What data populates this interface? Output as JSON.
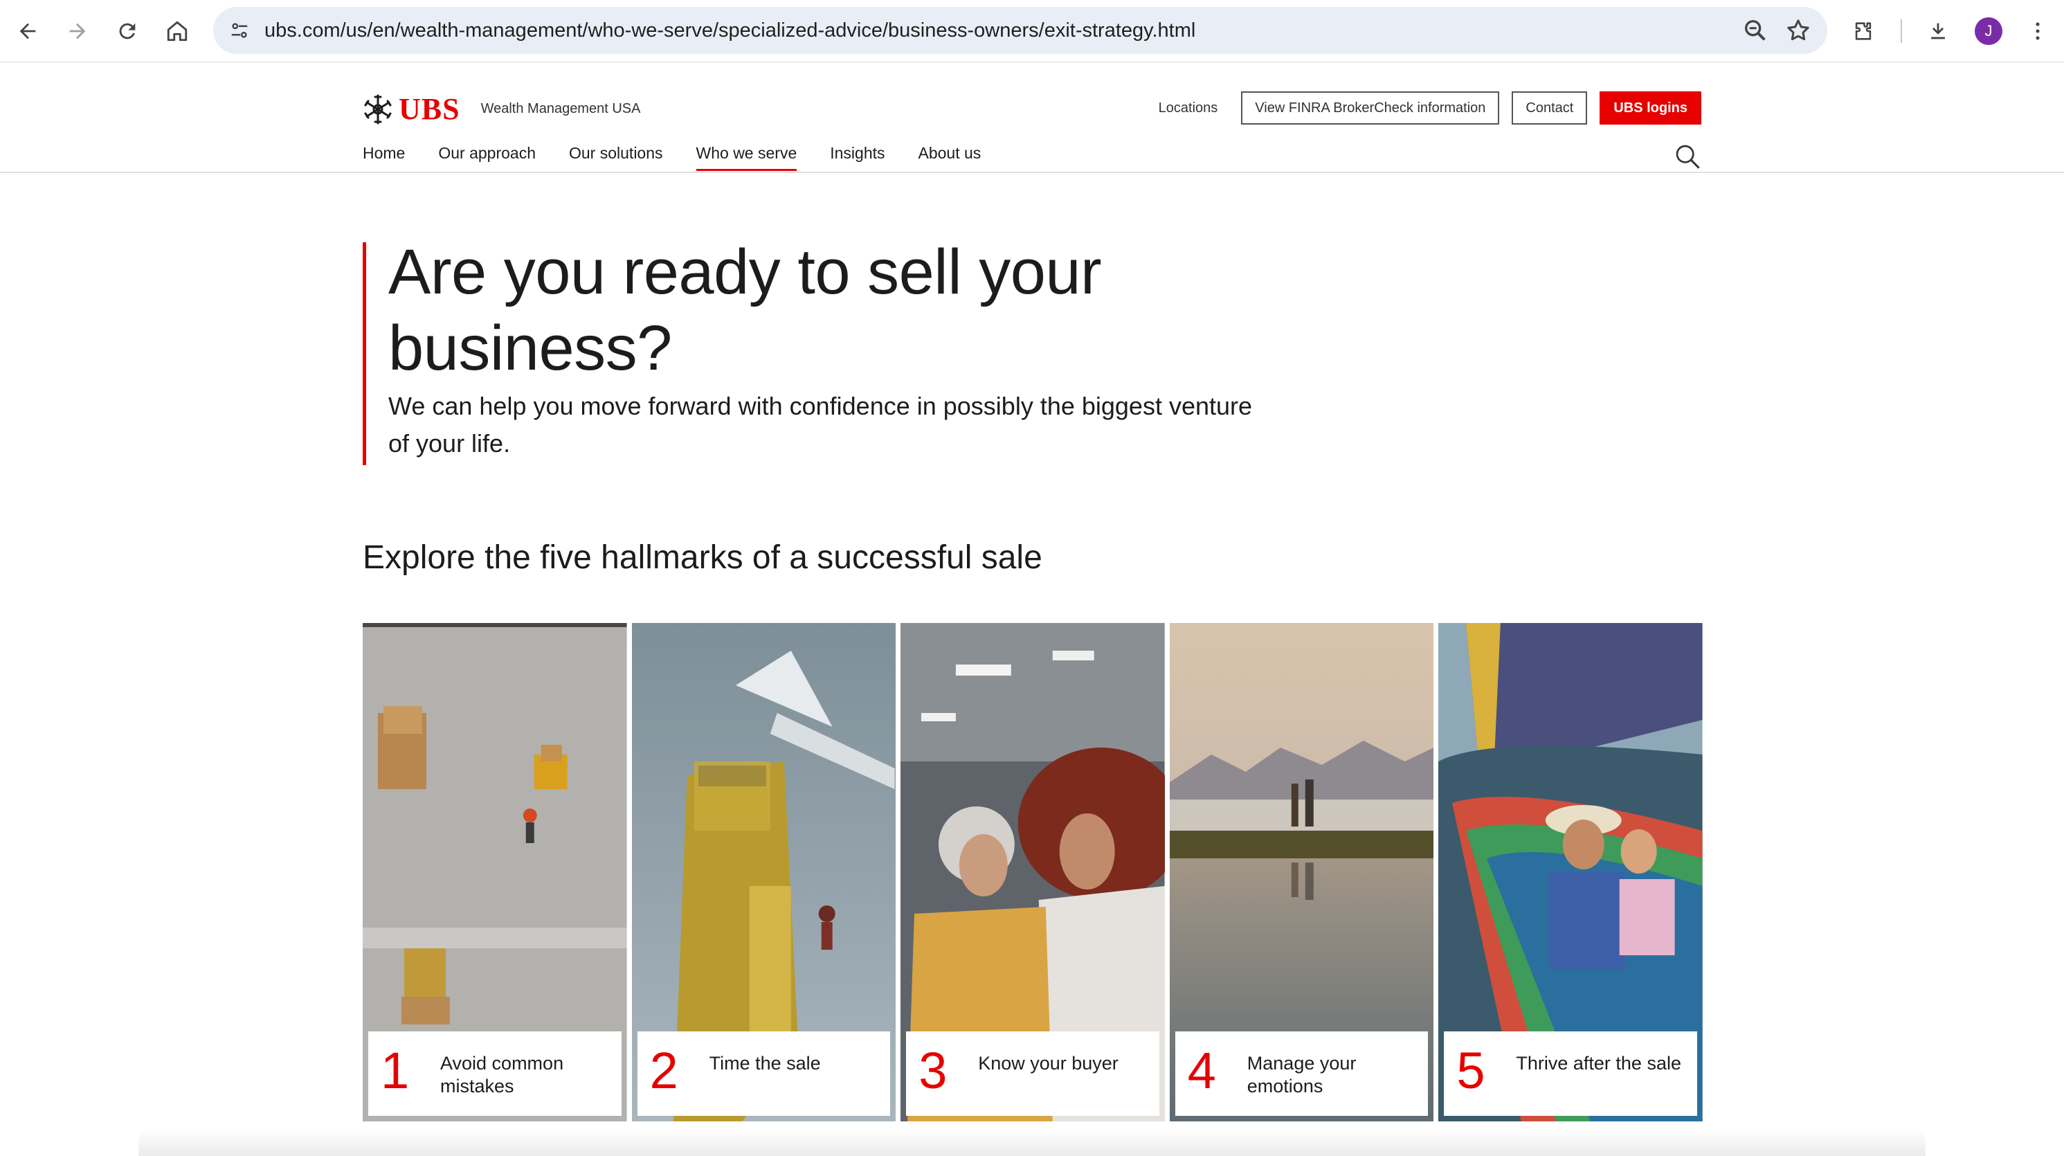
{
  "browser": {
    "url": "ubs.com/us/en/wealth-management/who-we-serve/specialized-advice/business-owners/exit-strategy.html",
    "avatar_letter": "J"
  },
  "header": {
    "logo_text": "UBS",
    "logo_subtitle": "Wealth Management USA",
    "locations": "Locations",
    "finra": "View FINRA BrokerCheck information",
    "contact": "Contact",
    "logins": "UBS logins",
    "brand_red": "#e60000"
  },
  "nav": {
    "items": [
      {
        "label": "Home"
      },
      {
        "label": "Our approach"
      },
      {
        "label": "Our solutions"
      },
      {
        "label": "Who we serve",
        "active": true
      },
      {
        "label": "Insights"
      },
      {
        "label": "About us"
      }
    ]
  },
  "hero": {
    "title": "Are you ready to sell your business?",
    "subtitle": "We can help you move forward with confidence in possibly the biggest venture of your life."
  },
  "section": {
    "title": "Explore the five hallmarks of a successful sale"
  },
  "cards": [
    {
      "num": "1",
      "text": "Avoid common mistakes"
    },
    {
      "num": "2",
      "text": "Time the sale"
    },
    {
      "num": "3",
      "text": "Know your buyer"
    },
    {
      "num": "4",
      "text": "Manage your emotions"
    },
    {
      "num": "5",
      "text": "Thrive after the sale"
    }
  ]
}
